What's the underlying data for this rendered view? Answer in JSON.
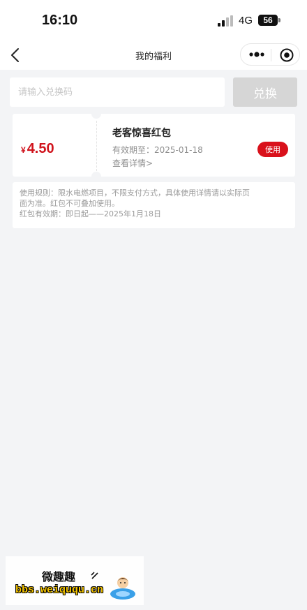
{
  "status_bar": {
    "time": "16:10",
    "network": "4G",
    "battery": "56"
  },
  "nav": {
    "title": "我的福利"
  },
  "redeem": {
    "placeholder": "请输入兑换码",
    "button_label": "兑换"
  },
  "coupon": {
    "currency_symbol": "¥",
    "amount": "4.50",
    "title": "老客惊喜红包",
    "expiry": "有效期至：2025-01-18",
    "details_link": "查看详情>",
    "use_label": "使用"
  },
  "rules": {
    "line1": "使用规则：限水电燃项目，不限支付方式，具体使用详情请以实际页",
    "line2": "面为准。红包不可叠加使用。",
    "line3": "红包有效期：即日起——2025年1月18日"
  },
  "watermark": {
    "title": "微趣趣",
    "url": "bbs.weiququ.cn"
  },
  "colors": {
    "accent_red": "#d9111b",
    "page_background": "#f3f4f6",
    "disabled_button": "#d6d6d6"
  },
  "icons": [
    "back-chevron-icon",
    "more-dots-icon",
    "close-target-icon",
    "signal-icon"
  ]
}
